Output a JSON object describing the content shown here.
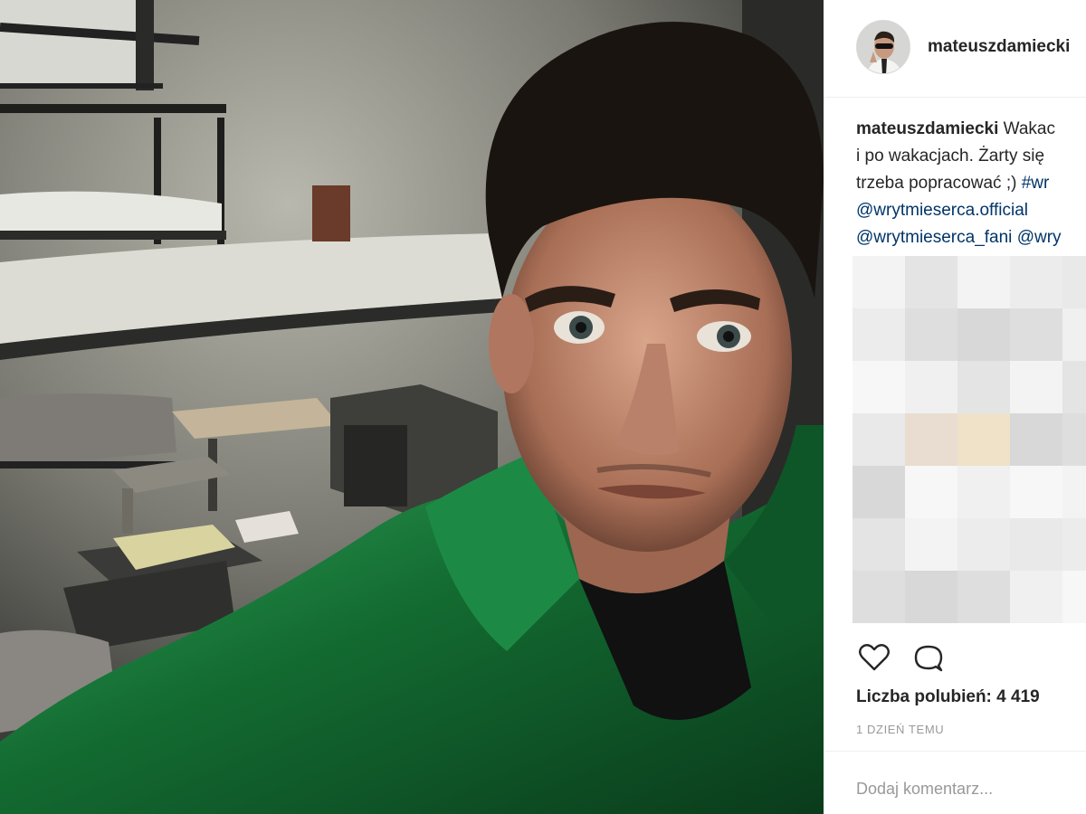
{
  "post": {
    "image_icon": "selfie-photo-prison-cell",
    "author": {
      "username": "mateuszdamiecki",
      "avatar_icon": "profile-avatar"
    },
    "caption": {
      "username": "mateuszdamiecki",
      "line1": "Wakac",
      "line2": "i po wakacjach. Żarty się",
      "line3_text": "trzeba popracować ;)",
      "line3_hashtag": "#wr",
      "mention1": "@wrytmieserca.official",
      "mention2": "@wrytmieserca_fani",
      "mention3": "@wry"
    },
    "actions": {
      "like_icon": "heart-icon",
      "comment_icon": "comment-bubble-icon"
    },
    "likes_label": "Liczba polubień: 4 419",
    "timestamp": "1 DZIEŃ TEMU",
    "comment_placeholder": "Dodaj komentarz..."
  },
  "colors": {
    "link": "#003569",
    "muted": "#999999",
    "text": "#262626",
    "shirt_green": "#1d7a3a"
  }
}
